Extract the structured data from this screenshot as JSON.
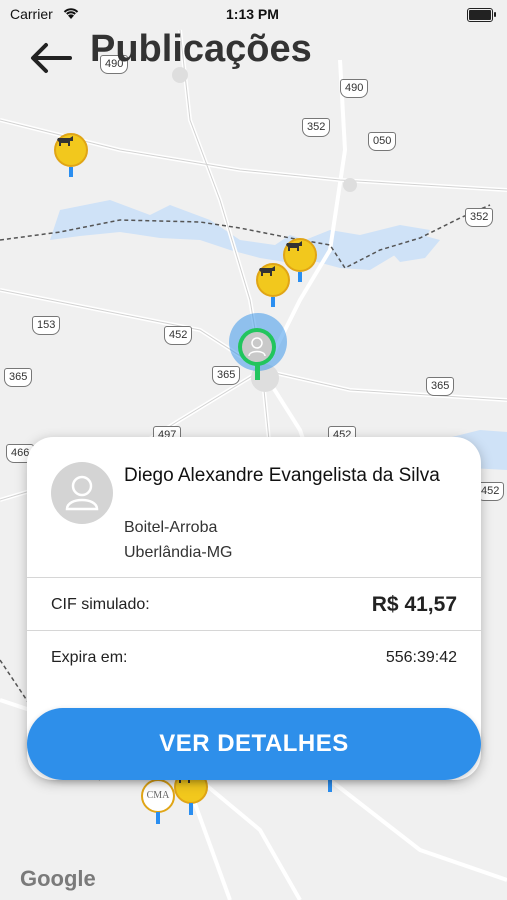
{
  "status_bar": {
    "carrier": "Carrier",
    "time": "1:13 PM"
  },
  "header": {
    "title": "Publicações"
  },
  "map": {
    "road_labels": [
      "490",
      "490",
      "352",
      "050",
      "352",
      "153",
      "452",
      "365",
      "365",
      "365",
      "497",
      "452",
      "466",
      "452"
    ],
    "cma_badge": "CMA",
    "attribution": "Google"
  },
  "card": {
    "name": "Diego Alexandre Evangelista da Silva",
    "category": "Boitel-Arroba",
    "location": "Uberlândia-MG",
    "cif_label": "CIF simulado:",
    "cif_value": "R$ 41,57",
    "expire_label": "Expira em:",
    "expire_value": "556:39:42"
  },
  "action": {
    "details_label": "VER DETALHES"
  },
  "colors": {
    "accent": "#2e8fea",
    "pin_yellow": "#f2c81d",
    "selected_green": "#22c55e"
  }
}
